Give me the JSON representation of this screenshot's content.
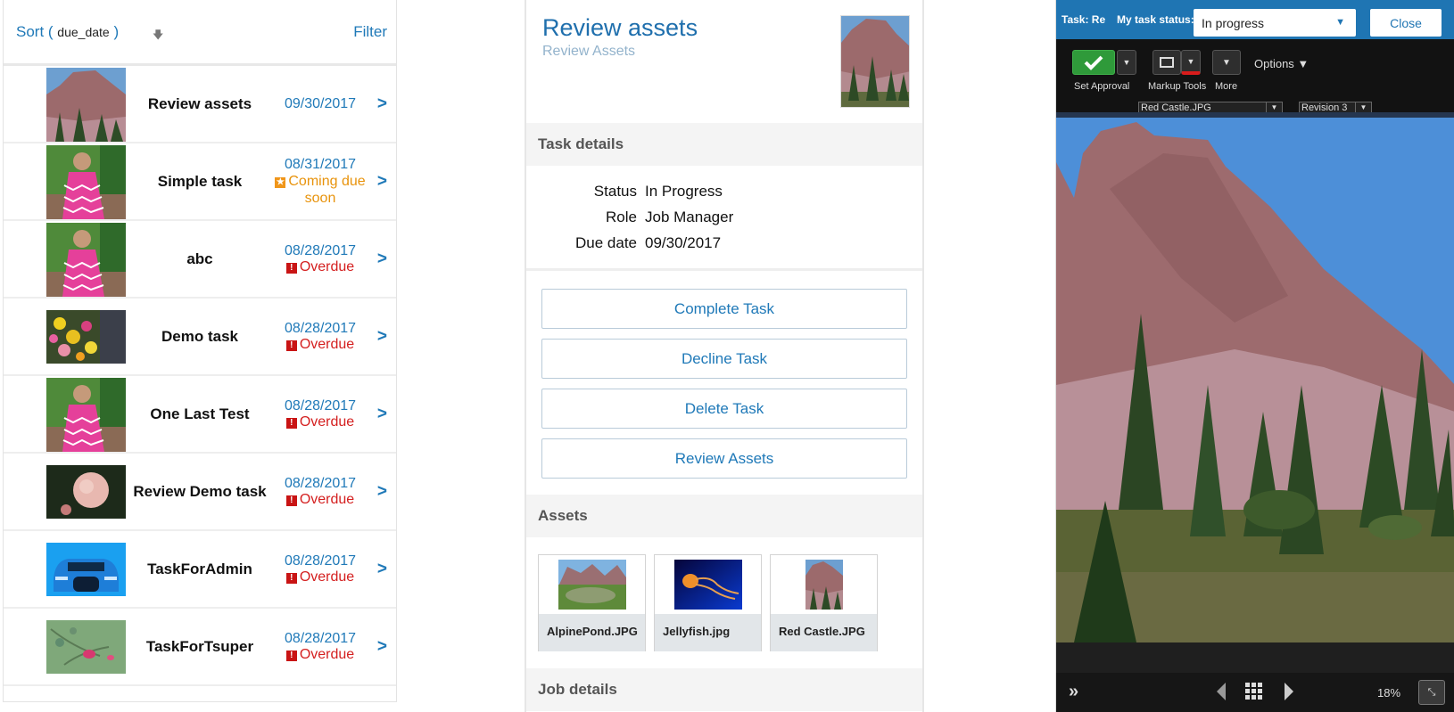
{
  "task_list": {
    "sort_label": "Sort (",
    "sort_field": "due_date",
    "sort_close": ")",
    "sort_direction_icon": "arrow-down",
    "filter_label": "Filter",
    "rows": [
      {
        "name": "Review assets",
        "date": "09/30/2017",
        "status": "",
        "status_type": "none",
        "thumb": "red-castle"
      },
      {
        "name": "Simple task",
        "date": "08/31/2017",
        "status": "Coming due soon",
        "status_type": "coming-due",
        "thumb": "girl-pink-dress"
      },
      {
        "name": "abc",
        "date": "08/28/2017",
        "status": "Overdue",
        "status_type": "overdue",
        "thumb": "girl-pink-dress"
      },
      {
        "name": "Demo task",
        "date": "08/28/2017",
        "status": "Overdue",
        "status_type": "overdue",
        "thumb": "flowers"
      },
      {
        "name": "One Last Test",
        "date": "08/28/2017",
        "status": "Overdue",
        "status_type": "overdue",
        "thumb": "girl-pink-dress"
      },
      {
        "name": "Review Demo task",
        "date": "08/28/2017",
        "status": "Overdue",
        "status_type": "overdue",
        "thumb": "pink-rose"
      },
      {
        "name": "TaskForAdmin",
        "date": "08/28/2017",
        "status": "Overdue",
        "status_type": "overdue",
        "thumb": "blue-car"
      },
      {
        "name": "TaskForTsuper",
        "date": "08/28/2017",
        "status": "Overdue",
        "status_type": "overdue",
        "thumb": "rose-buds"
      }
    ],
    "chevron": ">",
    "coming_due_line1": "Coming due",
    "coming_due_line2": "soon"
  },
  "task_detail": {
    "title": "Review assets",
    "subtitle": "Review Assets",
    "sections": {
      "task_details": "Task details",
      "assets": "Assets",
      "job_details": "Job details"
    },
    "fields": [
      {
        "key": "Status",
        "value": "In Progress"
      },
      {
        "key": "Role",
        "value": "Job Manager"
      },
      {
        "key": "Due date",
        "value": "09/30/2017"
      }
    ],
    "buttons": [
      "Complete Task",
      "Decline Task",
      "Delete Task",
      "Review Assets"
    ],
    "assets": [
      {
        "name": "AlpinePond.JPG"
      },
      {
        "name": "Jellyfish.jpg"
      },
      {
        "name": "Red Castle.JPG"
      }
    ]
  },
  "viewer": {
    "task_label": "Task: Re",
    "status_label": "My task status:",
    "status_value": "In progress",
    "close_label": "Close",
    "tools": {
      "set_approval": "Set Approval",
      "markup_tools": "Markup Tools",
      "more": "More",
      "options": "Options ▼"
    },
    "file_select": "Red Castle.JPG",
    "revision_select": "Revision 3",
    "zoom": "18%",
    "colors": {
      "header": "#1f75b3",
      "approval_green": "#2f9a3a",
      "markup_red": "#d81c1c"
    }
  },
  "colors": {
    "link_blue": "#1f79b8",
    "overdue_red": "#d41f1f",
    "coming_due_orange": "#e8930c"
  }
}
